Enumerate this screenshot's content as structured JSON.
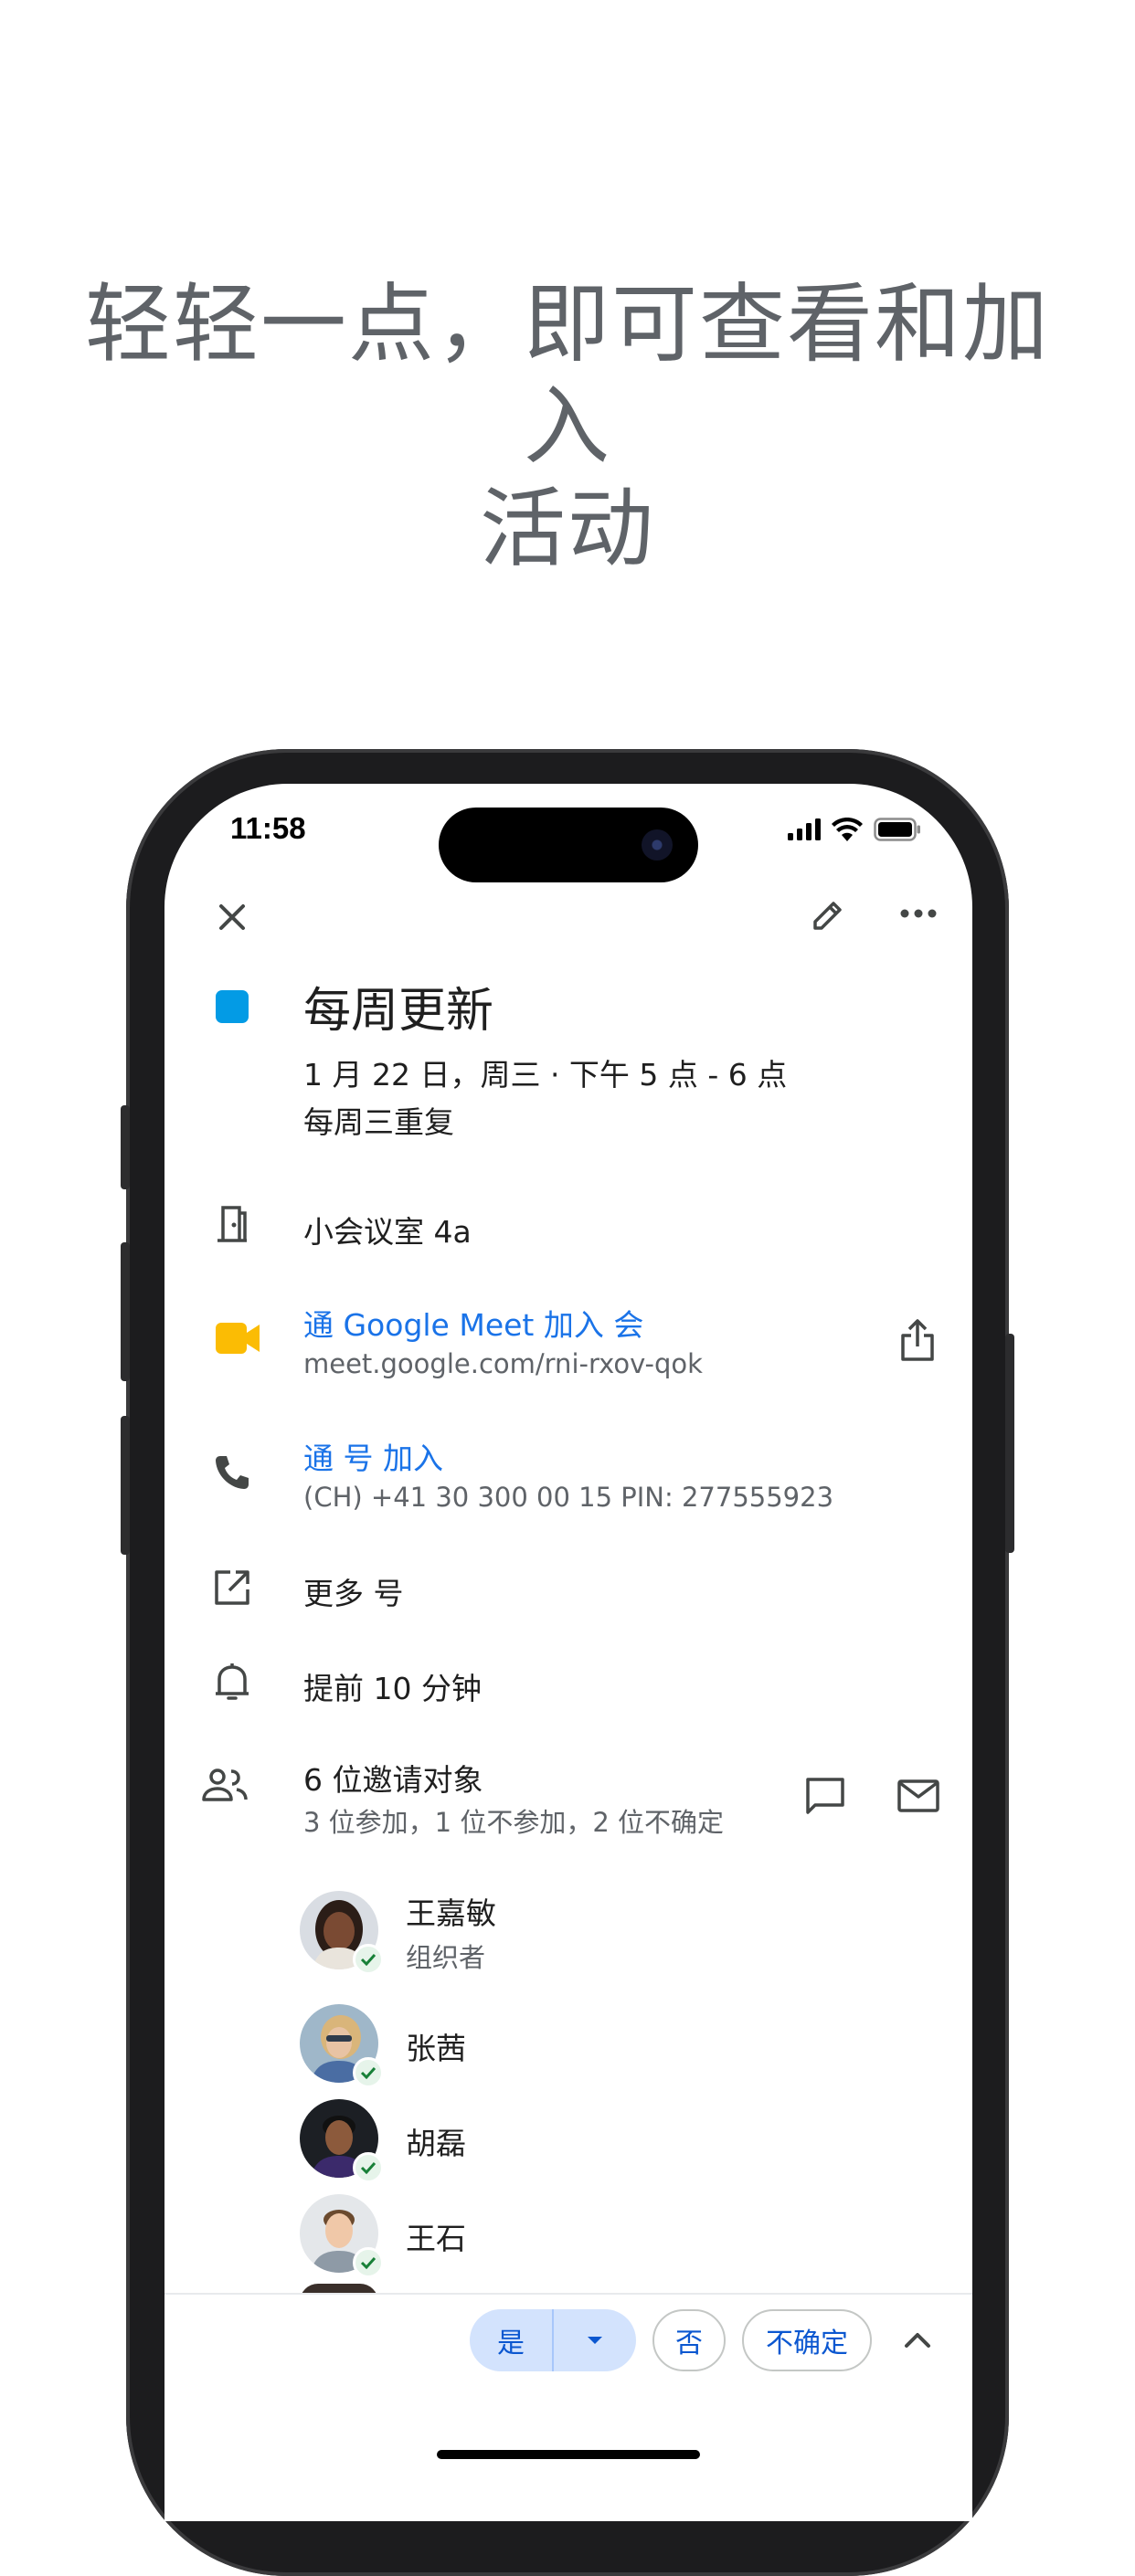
{
  "headline": {
    "line1": "轻轻一点，即可查看和加入",
    "line2": "活动"
  },
  "status_bar": {
    "time": "11:58"
  },
  "event": {
    "title": "每周更新",
    "datetime": "1 月 22 日，周三 · 下午 5 点 - 6 点",
    "recurrence": "每周三重复",
    "color": "#039be5",
    "room": "小会议室 4a",
    "meet_link_label": "通    Google Meet 加入      会",
    "meet_url": "meet.google.com/rni-rxov-qok",
    "phone_label": "通          号   加入",
    "phone_number": "(CH) +41 30 300 00 15 PIN: 277555923",
    "more_numbers": "更多      号",
    "reminder": "提前 10 分钟",
    "guests_title": "6 位邀请对象",
    "guests_summary": "3 位参加，1 位不参加，2 位不确定"
  },
  "guests": [
    {
      "name": "王嘉敏",
      "role": "组织者"
    },
    {
      "name": "张茜",
      "role": ""
    },
    {
      "name": "胡磊",
      "role": ""
    },
    {
      "name": "王石",
      "role": ""
    }
  ],
  "rsvp": {
    "yes": "是",
    "no": "否",
    "maybe": "不确定"
  },
  "colors": {
    "accent": "#1a73e8",
    "meet_yellow": "#fbbc04",
    "check_green": "#188038"
  }
}
